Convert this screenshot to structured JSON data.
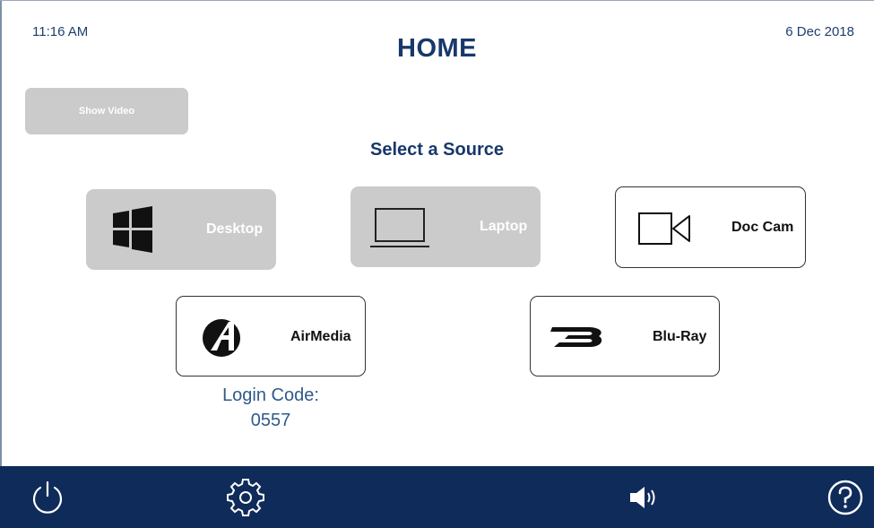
{
  "status": {
    "time": "11:16 AM",
    "date": "6 Dec 2018"
  },
  "header": {
    "title": "HOME"
  },
  "show_video": {
    "label": "Show Video"
  },
  "section": {
    "heading": "Select a Source"
  },
  "sources": [
    {
      "label": "Desktop",
      "icon": "windows-icon",
      "state": "disabled"
    },
    {
      "label": "Laptop",
      "icon": "laptop-icon",
      "state": "disabled"
    },
    {
      "label": "Doc Cam",
      "icon": "video-camera-icon",
      "state": "enabled"
    },
    {
      "label": "AirMedia",
      "icon": "airmedia-icon",
      "state": "enabled"
    },
    {
      "label": "Blu-Ray",
      "icon": "blu-ray-icon",
      "state": "enabled"
    }
  ],
  "airmedia": {
    "login_label": "Login Code:",
    "login_code": "0557"
  },
  "bottom_bar": {
    "icons": [
      "power-icon",
      "gear-icon",
      "volume-icon",
      "help-icon"
    ]
  },
  "colors": {
    "brand_navy": "#0f2b5a",
    "heading_blue": "#17386b",
    "disabled_gray": "#cbcbcb"
  }
}
